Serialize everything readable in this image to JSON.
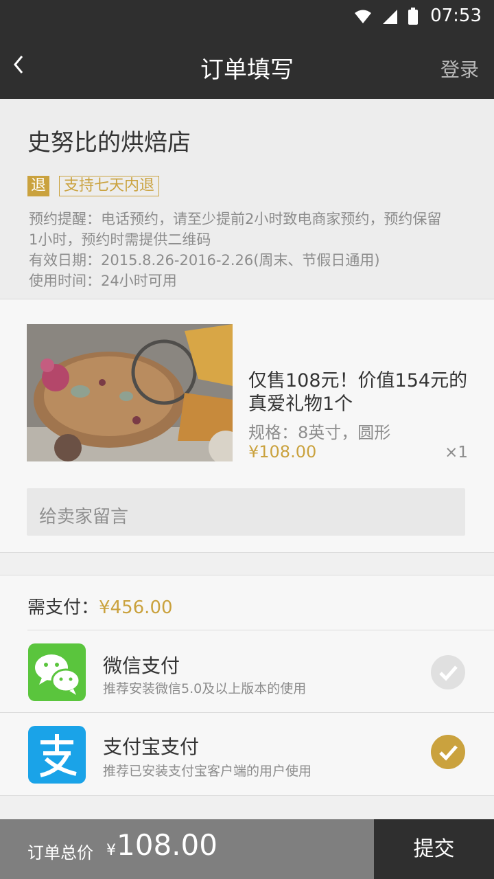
{
  "status": {
    "time": "07:53"
  },
  "header": {
    "title": "订单填写",
    "login": "登录"
  },
  "shop": {
    "name": "史努比的烘焙店",
    "badge": "退",
    "refund_tag": "支持七天内退",
    "reminder_line1": "预约提醒：电话预约，请至少提前2小时致电商家预约，预约保留",
    "reminder_line2": "1小时，预约时需提供二维码",
    "validity": "有效日期：2015.8.26-2016-2.26(周末、节假日通用)",
    "usage_time": "使用时间：24小时可用"
  },
  "product": {
    "title": "仅售108元！价值154元的真爱礼物1个",
    "spec": "规格：8英寸，圆形",
    "price": "¥108.00",
    "quantity": "×1",
    "message_placeholder": "给卖家留言"
  },
  "payment": {
    "need_pay_label": "需支付：",
    "need_pay_amount": "¥456.00",
    "methods": [
      {
        "name": "微信支付",
        "desc": "推荐安装微信5.0及以上版本的使用",
        "icon": "wechat-icon",
        "selected": false
      },
      {
        "name": "支付宝支付",
        "desc": "推荐已安装支付宝客户端的用户使用",
        "icon": "alipay-icon",
        "selected": true
      }
    ]
  },
  "footer": {
    "total_label": "订单总价",
    "currency": "¥",
    "total_amount": "108.00",
    "submit": "提交"
  },
  "colors": {
    "accent": "#caa23e",
    "header_bg": "#2f2f2f",
    "wechat": "#5ac53d",
    "alipay": "#1aa3e8"
  }
}
